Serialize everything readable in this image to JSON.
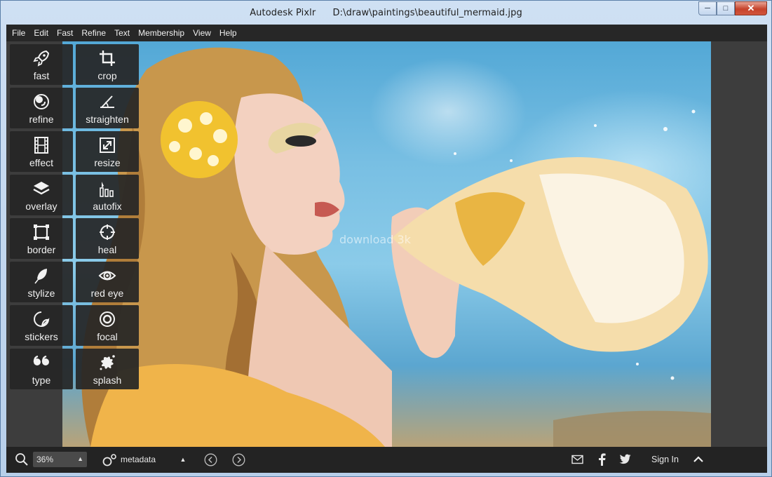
{
  "window": {
    "app_name": "Autodesk Pixlr",
    "file_path": "D:\\draw\\paintings\\beautiful_mermaid.jpg",
    "controls": {
      "minimize": "─",
      "maximize": "□",
      "close": "✕"
    }
  },
  "menu": [
    "File",
    "Edit",
    "Fast",
    "Refine",
    "Text",
    "Membership",
    "View",
    "Help"
  ],
  "tools": [
    {
      "label": "fast",
      "icon": "rocket-icon"
    },
    {
      "label": "crop",
      "icon": "crop-icon"
    },
    {
      "label": "refine",
      "icon": "refine-icon"
    },
    {
      "label": "straighten",
      "icon": "straighten-icon"
    },
    {
      "label": "effect",
      "icon": "film-icon"
    },
    {
      "label": "resize",
      "icon": "resize-icon"
    },
    {
      "label": "overlay",
      "icon": "layers-icon"
    },
    {
      "label": "autofix",
      "icon": "autofix-icon"
    },
    {
      "label": "border",
      "icon": "border-icon"
    },
    {
      "label": "heal",
      "icon": "crosshair-icon"
    },
    {
      "label": "stylize",
      "icon": "feather-icon"
    },
    {
      "label": "red eye",
      "icon": "eye-icon"
    },
    {
      "label": "stickers",
      "icon": "sticker-icon"
    },
    {
      "label": "focal",
      "icon": "focal-icon"
    },
    {
      "label": "type",
      "icon": "quote-icon"
    },
    {
      "label": "splash",
      "icon": "splash-icon"
    }
  ],
  "bottom": {
    "zoom_value": "36%",
    "metadata_label": "metadata",
    "sign_in": "Sign In"
  },
  "photo": {
    "watermark": "download 3k"
  },
  "colors": {
    "accent_sky": "#6a9ccc",
    "panel": "#262626",
    "bar": "#232323"
  }
}
